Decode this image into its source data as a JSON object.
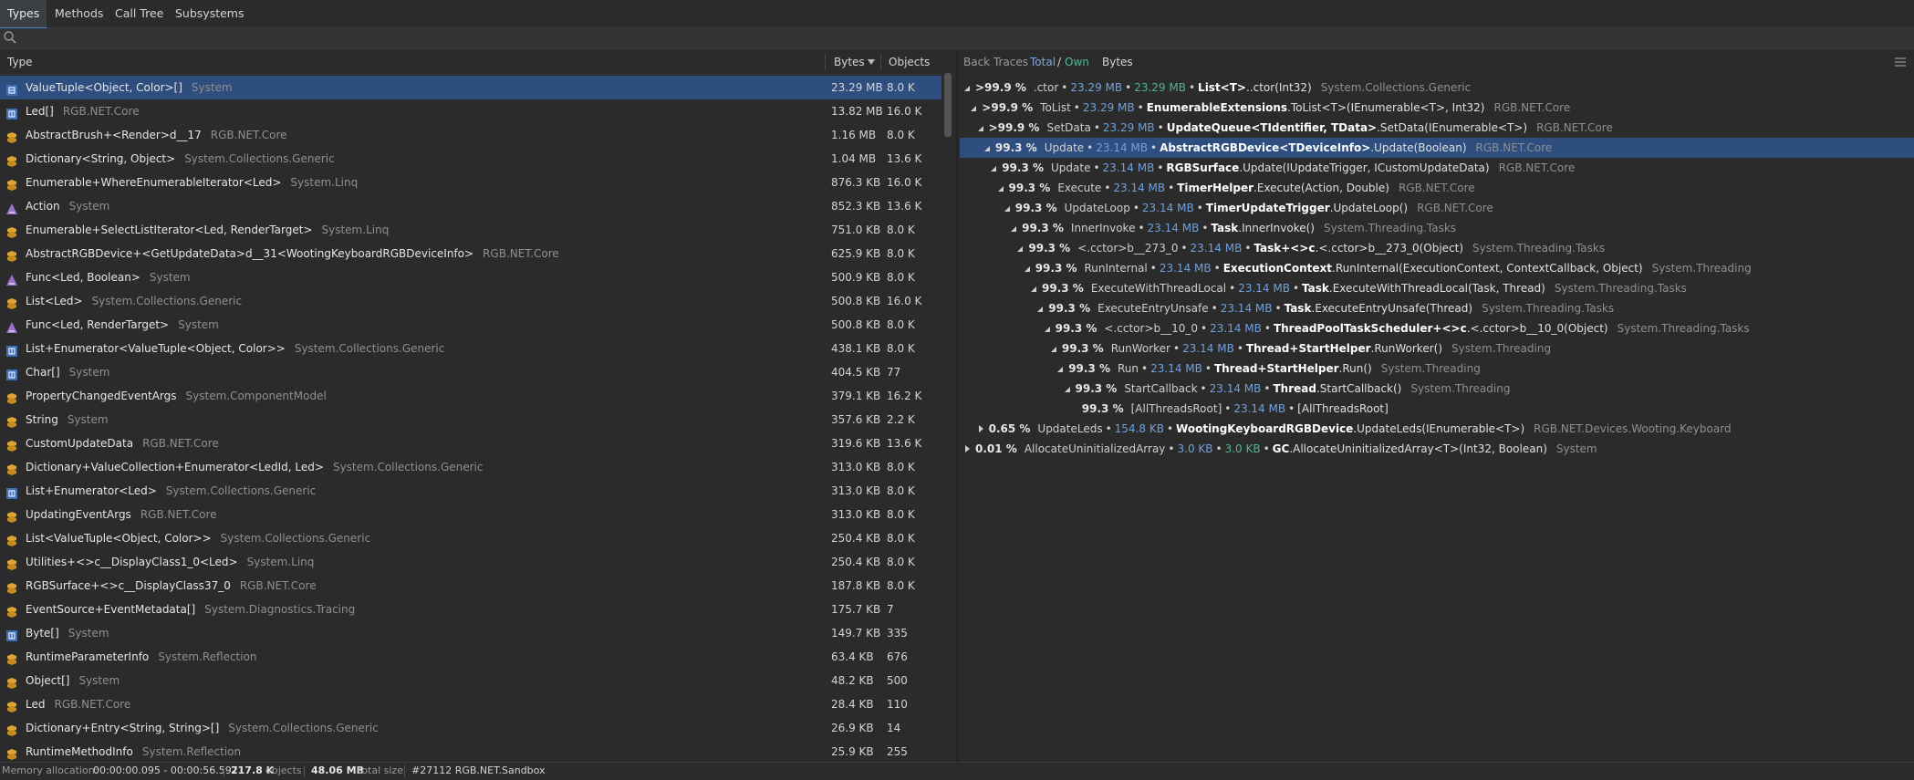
{
  "tabs": [
    "Types",
    "Methods",
    "Call Tree",
    "Subsystems"
  ],
  "search": {
    "placeholder": ""
  },
  "left": {
    "columns": {
      "type": "Type",
      "bytes": "Bytes",
      "objects": "Objects"
    },
    "rows": [
      {
        "icon": "class",
        "name": "ValueTuple<Object, Color>[]",
        "ns": "System",
        "bytes": "23.29 MB",
        "objects": "8.0 K"
      },
      {
        "icon": "struct",
        "name": "Led[]",
        "ns": "RGB.NET.Core",
        "bytes": "13.82 MB",
        "objects": "16.0 K"
      },
      {
        "icon": "class-gen",
        "name": "AbstractBrush+<Render>d__17",
        "ns": "RGB.NET.Core",
        "bytes": "1.16 MB",
        "objects": "8.0 K"
      },
      {
        "icon": "class-gen",
        "name": "Dictionary<String, Object>",
        "ns": "System.Collections.Generic",
        "bytes": "1.04 MB",
        "objects": "13.6 K"
      },
      {
        "icon": "class-gen",
        "name": "Enumerable+WhereEnumerableIterator<Led>",
        "ns": "System.Linq",
        "bytes": "876.3 KB",
        "objects": "16.0 K"
      },
      {
        "icon": "delegate",
        "name": "Action",
        "ns": "System",
        "bytes": "852.3 KB",
        "objects": "13.6 K"
      },
      {
        "icon": "class-gen",
        "name": "Enumerable+SelectListIterator<Led, RenderTarget>",
        "ns": "System.Linq",
        "bytes": "751.0 KB",
        "objects": "8.0 K"
      },
      {
        "icon": "class-gen",
        "name": "AbstractRGBDevice+<GetUpdateData>d__31<WootingKeyboardRGBDeviceInfo>",
        "ns": "RGB.NET.Core",
        "bytes": "625.9 KB",
        "objects": "8.0 K"
      },
      {
        "icon": "delegate",
        "name": "Func<Led, Boolean>",
        "ns": "System",
        "bytes": "500.9 KB",
        "objects": "8.0 K"
      },
      {
        "icon": "class-gen",
        "name": "List<Led>",
        "ns": "System.Collections.Generic",
        "bytes": "500.8 KB",
        "objects": "16.0 K"
      },
      {
        "icon": "delegate",
        "name": "Func<Led, RenderTarget>",
        "ns": "System",
        "bytes": "500.8 KB",
        "objects": "8.0 K"
      },
      {
        "icon": "struct",
        "name": "List+Enumerator<ValueTuple<Object, Color>>",
        "ns": "System.Collections.Generic",
        "bytes": "438.1 KB",
        "objects": "8.0 K"
      },
      {
        "icon": "struct",
        "name": "Char[]",
        "ns": "System",
        "bytes": "404.5 KB",
        "objects": "77"
      },
      {
        "icon": "class-gen",
        "name": "PropertyChangedEventArgs",
        "ns": "System.ComponentModel",
        "bytes": "379.1 KB",
        "objects": "16.2 K"
      },
      {
        "icon": "class-gen",
        "name": "String",
        "ns": "System",
        "bytes": "357.6 KB",
        "objects": "2.2 K"
      },
      {
        "icon": "class-gen",
        "name": "CustomUpdateData",
        "ns": "RGB.NET.Core",
        "bytes": "319.6 KB",
        "objects": "13.6 K"
      },
      {
        "icon": "class-gen",
        "name": "Dictionary+ValueCollection+Enumerator<LedId, Led>",
        "ns": "System.Collections.Generic",
        "bytes": "313.0 KB",
        "objects": "8.0 K"
      },
      {
        "icon": "struct",
        "name": "List+Enumerator<Led>",
        "ns": "System.Collections.Generic",
        "bytes": "313.0 KB",
        "objects": "8.0 K"
      },
      {
        "icon": "class-gen",
        "name": "UpdatingEventArgs",
        "ns": "RGB.NET.Core",
        "bytes": "313.0 KB",
        "objects": "8.0 K"
      },
      {
        "icon": "class-gen",
        "name": "List<ValueTuple<Object, Color>>",
        "ns": "System.Collections.Generic",
        "bytes": "250.4 KB",
        "objects": "8.0 K"
      },
      {
        "icon": "class-gen",
        "name": "Utilities+<>c__DisplayClass1_0<Led>",
        "ns": "System.Linq",
        "bytes": "250.4 KB",
        "objects": "8.0 K"
      },
      {
        "icon": "class-gen",
        "name": "RGBSurface+<>c__DisplayClass37_0",
        "ns": "RGB.NET.Core",
        "bytes": "187.8 KB",
        "objects": "8.0 K"
      },
      {
        "icon": "class-gen",
        "name": "EventSource+EventMetadata[]",
        "ns": "System.Diagnostics.Tracing",
        "bytes": "175.7 KB",
        "objects": "7"
      },
      {
        "icon": "struct",
        "name": "Byte[]",
        "ns": "System",
        "bytes": "149.7 KB",
        "objects": "335"
      },
      {
        "icon": "class-gen",
        "name": "RuntimeParameterInfo",
        "ns": "System.Reflection",
        "bytes": "63.4 KB",
        "objects": "676"
      },
      {
        "icon": "class-gen",
        "name": "Object[]",
        "ns": "System",
        "bytes": "48.2 KB",
        "objects": "500"
      },
      {
        "icon": "class-gen",
        "name": "Led",
        "ns": "RGB.NET.Core",
        "bytes": "28.4 KB",
        "objects": "110"
      },
      {
        "icon": "class-gen",
        "name": "Dictionary+Entry<String, String>[]",
        "ns": "System.Collections.Generic",
        "bytes": "26.9 KB",
        "objects": "14"
      },
      {
        "icon": "class-gen",
        "name": "RuntimeMethodInfo",
        "ns": "System.Reflection",
        "bytes": "25.9 KB",
        "objects": "255"
      }
    ]
  },
  "right": {
    "header": {
      "back_traces": "Back Traces",
      "total": "Total",
      "slash": "/",
      "own": "Own",
      "bytes": "Bytes"
    },
    "rows": [
      {
        "depth": 0,
        "arrow": "down",
        "pct": ">99.9 %",
        "fn": ".ctor",
        "total": "23.29 MB",
        "own": "23.29 MB",
        "cls": "List<T>",
        "mth": "..ctor(Int32)",
        "ns": "System.Collections.Generic"
      },
      {
        "depth": 1,
        "arrow": "down",
        "pct": ">99.9 %",
        "fn": "ToList",
        "total": "23.29 MB",
        "own": "",
        "cls": "EnumerableExtensions",
        "mth": ".ToList<T>(IEnumerable<T>, Int32)",
        "ns": "RGB.NET.Core"
      },
      {
        "depth": 2,
        "arrow": "down",
        "pct": ">99.9 %",
        "fn": "SetData",
        "total": "23.29 MB",
        "own": "",
        "cls": "UpdateQueue<TIdentifier, TData>",
        "mth": ".SetData(IEnumerable<T>)",
        "ns": "RGB.NET.Core"
      },
      {
        "depth": 3,
        "arrow": "down",
        "pct": "99.3 %",
        "fn": "Update",
        "total": "23.14 MB",
        "own": "",
        "cls": "AbstractRGBDevice<TDeviceInfo>",
        "mth": ".Update(Boolean)",
        "ns": "RGB.NET.Core",
        "selected": true
      },
      {
        "depth": 4,
        "arrow": "down",
        "pct": "99.3 %",
        "fn": "Update",
        "total": "23.14 MB",
        "own": "",
        "cls": "RGBSurface",
        "mth": ".Update(IUpdateTrigger, ICustomUpdateData)",
        "ns": "RGB.NET.Core"
      },
      {
        "depth": 5,
        "arrow": "down",
        "pct": "99.3 %",
        "fn": "Execute",
        "total": "23.14 MB",
        "own": "",
        "cls": "TimerHelper",
        "mth": ".Execute(Action, Double)",
        "ns": "RGB.NET.Core"
      },
      {
        "depth": 6,
        "arrow": "down",
        "pct": "99.3 %",
        "fn": "UpdateLoop",
        "total": "23.14 MB",
        "own": "",
        "cls": "TimerUpdateTrigger",
        "mth": ".UpdateLoop()",
        "ns": "RGB.NET.Core"
      },
      {
        "depth": 7,
        "arrow": "down",
        "pct": "99.3 %",
        "fn": "InnerInvoke",
        "total": "23.14 MB",
        "own": "",
        "cls": "Task",
        "mth": ".InnerInvoke()",
        "ns": "System.Threading.Tasks"
      },
      {
        "depth": 8,
        "arrow": "down",
        "pct": "99.3 %",
        "fn": "<.cctor>b__273_0",
        "total": "23.14 MB",
        "own": "",
        "cls": "Task+<>c",
        "mth": ".<.cctor>b__273_0(Object)",
        "ns": "System.Threading.Tasks"
      },
      {
        "depth": 9,
        "arrow": "down",
        "pct": "99.3 %",
        "fn": "RunInternal",
        "total": "23.14 MB",
        "own": "",
        "cls": "ExecutionContext",
        "mth": ".RunInternal(ExecutionContext, ContextCallback, Object)",
        "ns": "System.Threading"
      },
      {
        "depth": 10,
        "arrow": "down",
        "pct": "99.3 %",
        "fn": "ExecuteWithThreadLocal",
        "total": "23.14 MB",
        "own": "",
        "cls": "Task",
        "mth": ".ExecuteWithThreadLocal(Task, Thread)",
        "ns": "System.Threading.Tasks"
      },
      {
        "depth": 11,
        "arrow": "down",
        "pct": "99.3 %",
        "fn": "ExecuteEntryUnsafe",
        "total": "23.14 MB",
        "own": "",
        "cls": "Task",
        "mth": ".ExecuteEntryUnsafe(Thread)",
        "ns": "System.Threading.Tasks"
      },
      {
        "depth": 12,
        "arrow": "down",
        "pct": "99.3 %",
        "fn": "<.cctor>b__10_0",
        "total": "23.14 MB",
        "own": "",
        "cls": "ThreadPoolTaskScheduler+<>c",
        "mth": ".<.cctor>b__10_0(Object)",
        "ns": "System.Threading.Tasks"
      },
      {
        "depth": 13,
        "arrow": "down",
        "pct": "99.3 %",
        "fn": "RunWorker",
        "total": "23.14 MB",
        "own": "",
        "cls": "Thread+StartHelper",
        "mth": ".RunWorker()",
        "ns": "System.Threading"
      },
      {
        "depth": 14,
        "arrow": "down",
        "pct": "99.3 %",
        "fn": "Run",
        "total": "23.14 MB",
        "own": "",
        "cls": "Thread+StartHelper",
        "mth": ".Run()",
        "ns": "System.Threading"
      },
      {
        "depth": 15,
        "arrow": "down",
        "pct": "99.3 %",
        "fn": "StartCallback",
        "total": "23.14 MB",
        "own": "",
        "cls": "Thread",
        "mth": ".StartCallback()",
        "ns": "System.Threading"
      },
      {
        "depth": 16,
        "arrow": "none",
        "pct": "99.3 %",
        "fn": "[AllThreadsRoot]",
        "total": "23.14 MB",
        "own": "",
        "cls": "",
        "mth": "[AllThreadsRoot]",
        "ns": ""
      },
      {
        "depth": 2,
        "arrow": "right",
        "pct": "0.65 %",
        "fn": "UpdateLeds",
        "total": "154.8 KB",
        "own": "",
        "cls": "WootingKeyboardRGBDevice",
        "mth": ".UpdateLeds(IEnumerable<T>)",
        "ns": "RGB.NET.Devices.Wooting.Keyboard"
      },
      {
        "depth": 0,
        "arrow": "right",
        "pct": "0.01 %",
        "fn": "AllocateUninitializedArray",
        "total": "3.0 KB",
        "own": "3.0 KB",
        "cls": "GC",
        "mth": ".AllocateUninitializedArray<T>(Int32, Boolean)",
        "ns": "System"
      }
    ]
  },
  "status": {
    "mem_label": "Memory allocation:",
    "mem_range": "00:00:00.095 - 00:00:56.597",
    "objects_val": "217.8 K",
    "objects_label": "objects",
    "size_val": "48.06 MB",
    "size_label": "total size",
    "process": "#27112 RGB.NET.Sandbox"
  },
  "colors": {
    "accent": "#4a88c7",
    "selection": "#2d4e7e",
    "total": "#6fa0dc",
    "own": "#4fb39a"
  }
}
